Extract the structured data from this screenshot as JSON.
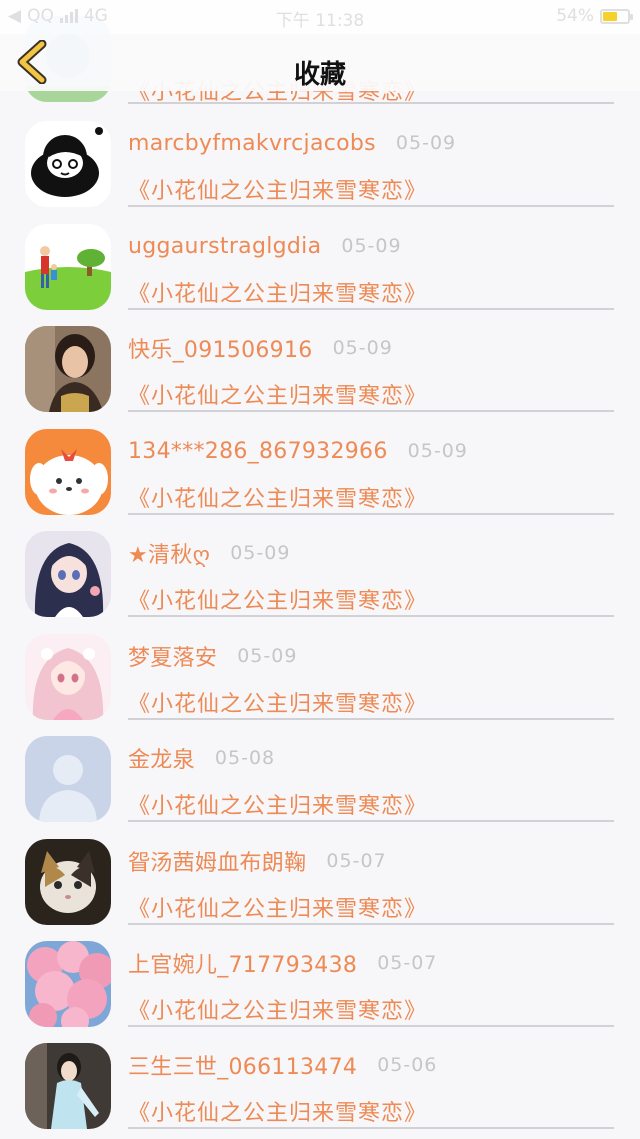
{
  "status_bar": {
    "carrier": "QQ",
    "network": "4G",
    "time": "下午 11:38",
    "battery": "54%",
    "colors": {
      "battery_fill": "#f4d12b",
      "text": "#dfdfe2"
    }
  },
  "nav": {
    "title": "收藏",
    "back_icon": "chevron-left-icon",
    "back_icon_color": "#e8b53d"
  },
  "theme": {
    "accent": "#ee8a55",
    "date_color": "#c6c6c8",
    "divider_color": "#d2d2d6"
  },
  "list": {
    "partial_top": {
      "title": "《小花仙之公主归来雪寒恋》"
    },
    "items": [
      {
        "name": "marcbyfmakvrcjacobs",
        "date": "05-09",
        "title": "《小花仙之公主归来雪寒恋》",
        "avatar": "cartoon-girl-avatar"
      },
      {
        "name": "uggaurstraglgdia",
        "date": "05-09",
        "title": "《小花仙之公主归来雪寒恋》",
        "avatar": "park-avatar"
      },
      {
        "name": "快乐_091506916",
        "date": "05-09",
        "title": "《小花仙之公主归来雪寒恋》",
        "avatar": "woman-photo-avatar"
      },
      {
        "name": "134***286_867932966",
        "date": "05-09",
        "title": "《小花仙之公主归来雪寒恋》",
        "avatar": "puppy-avatar"
      },
      {
        "name": "★清秋ღ",
        "date": "05-09",
        "title": "《小花仙之公主归来雪寒恋》",
        "avatar": "anime-girl-dark-avatar"
      },
      {
        "name": "梦夏落安",
        "date": "05-09",
        "title": "《小花仙之公主归来雪寒恋》",
        "avatar": "anime-girl-pink-avatar"
      },
      {
        "name": "金龙泉",
        "date": "05-08",
        "title": "《小花仙之公主归来雪寒恋》",
        "avatar": "default-person-avatar"
      },
      {
        "name": "眢汤茜姆血布朗鞠",
        "date": "05-07",
        "title": "《小花仙之公主归来雪寒恋》",
        "avatar": "cat-avatar"
      },
      {
        "name": "上官婉儿_717793438",
        "date": "05-07",
        "title": "《小花仙之公主归来雪寒恋》",
        "avatar": "blossom-avatar"
      },
      {
        "name": "三生三世_066113474",
        "date": "05-06",
        "title": "《小花仙之公主归来雪寒恋》",
        "avatar": "costume-woman-avatar"
      }
    ]
  }
}
